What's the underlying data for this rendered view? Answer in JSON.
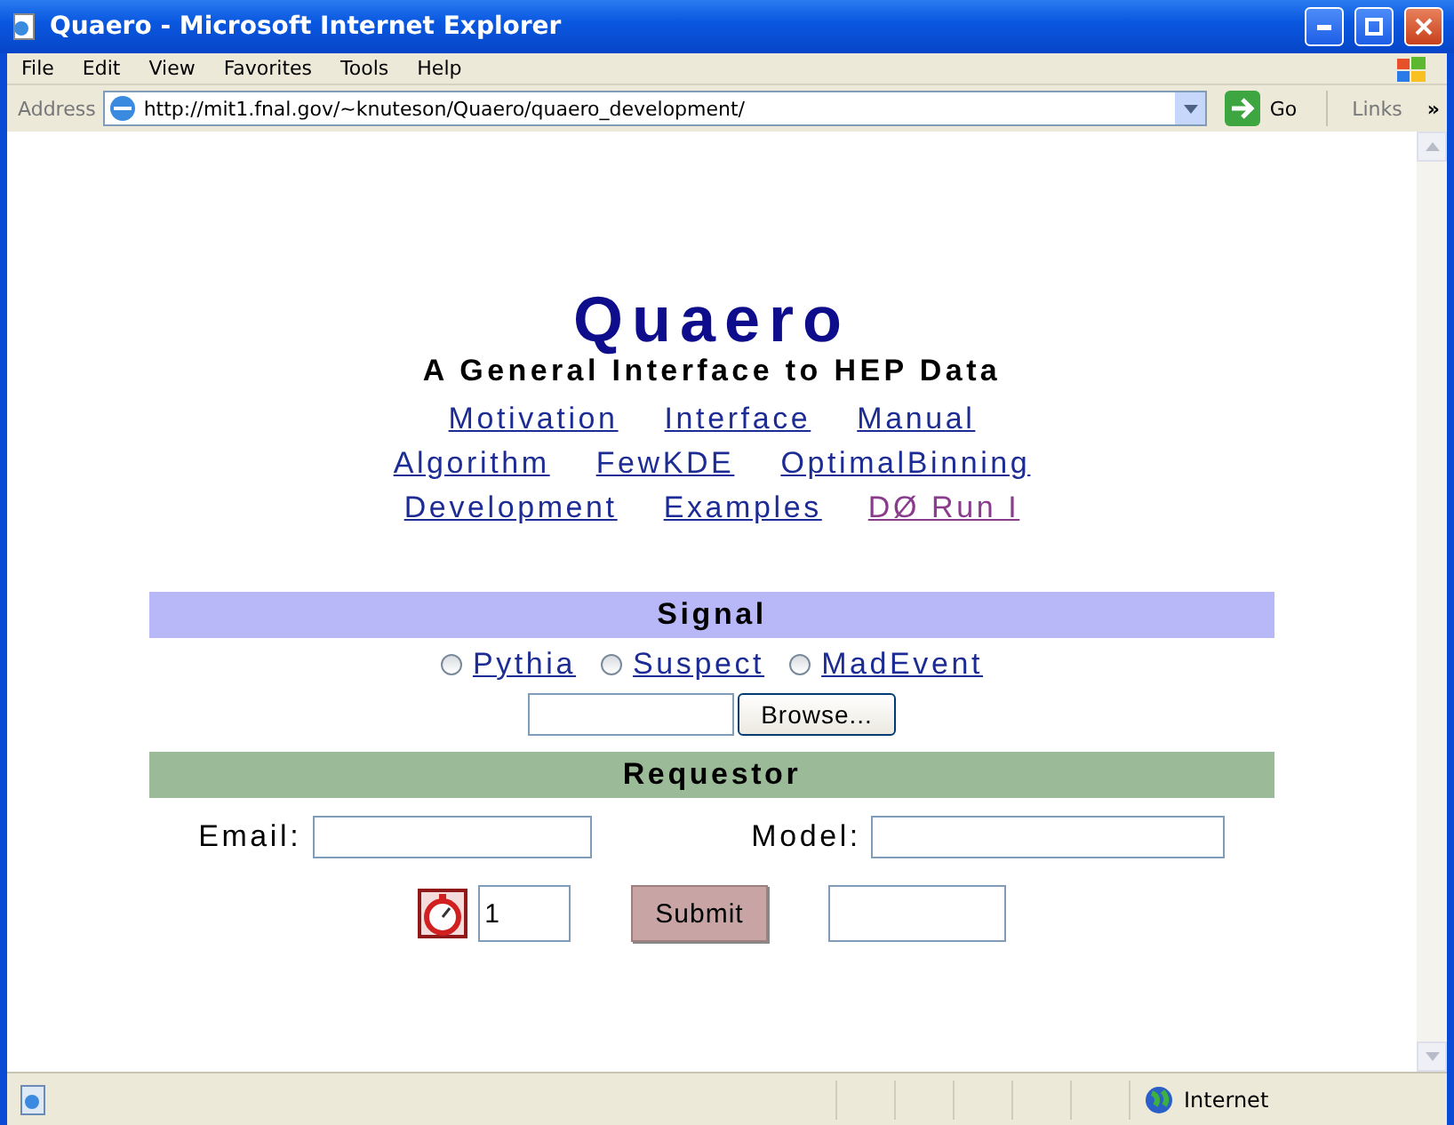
{
  "window": {
    "title": "Quaero - Microsoft Internet Explorer"
  },
  "menu": [
    "File",
    "Edit",
    "View",
    "Favorites",
    "Tools",
    "Help"
  ],
  "address_bar": {
    "label": "Address",
    "url": "http://mit1.fnal.gov/~knuteson/Quaero/quaero_development/",
    "go": "Go",
    "links": "Links",
    "more": "»"
  },
  "page": {
    "title": "Quaero",
    "subtitle": "A General Interface to HEP Data",
    "link_rows": [
      [
        {
          "label": "Motivation",
          "visited": false
        },
        {
          "label": "Interface",
          "visited": false
        },
        {
          "label": "Manual",
          "visited": false
        }
      ],
      [
        {
          "label": "Algorithm",
          "visited": false
        },
        {
          "label": "FewKDE",
          "visited": false
        },
        {
          "label": "OptimalBinning",
          "visited": false
        }
      ],
      [
        {
          "label": "Development",
          "visited": false
        },
        {
          "label": "Examples",
          "visited": false
        },
        {
          "label": "DØ Run I",
          "visited": true
        }
      ]
    ],
    "signal": {
      "heading": "Signal",
      "generators": [
        {
          "label": "Pythia",
          "selected": false
        },
        {
          "label": "Suspect",
          "selected": false
        },
        {
          "label": "MadEvent",
          "selected": false
        }
      ],
      "browse": "Browse..."
    },
    "requestor": {
      "heading": "Requestor",
      "email_label": "Email:",
      "model_label": "Model:",
      "count": "1",
      "submit": "Submit"
    }
  },
  "status_bar": {
    "zone": "Internet"
  }
}
